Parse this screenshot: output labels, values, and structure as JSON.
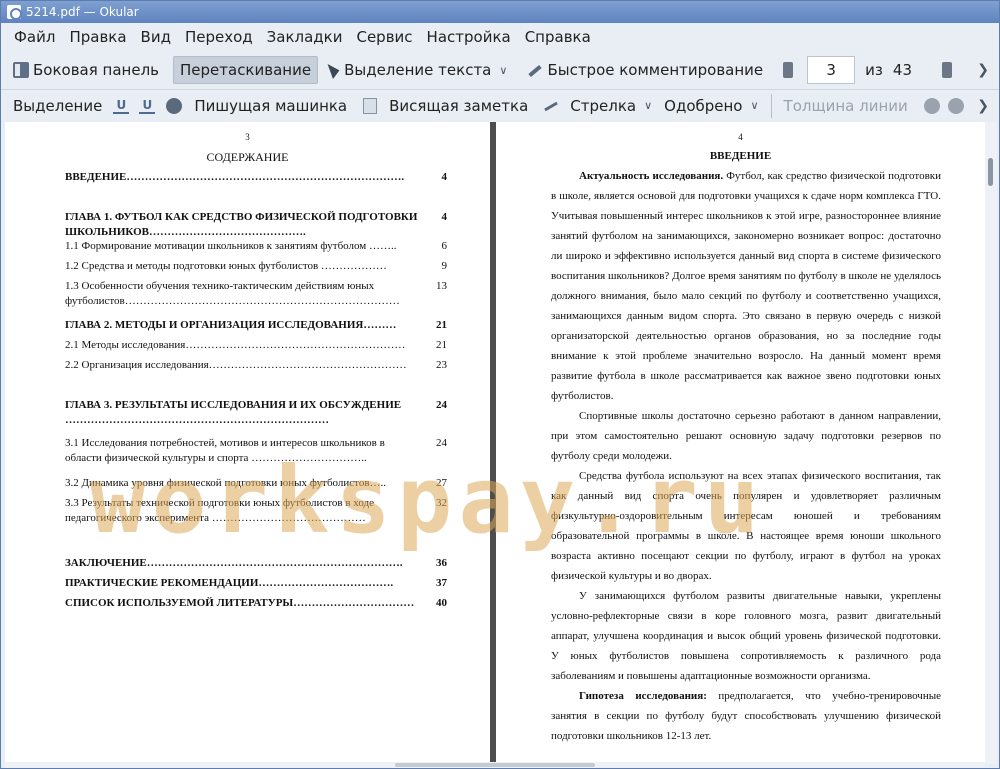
{
  "window": {
    "title": "5214.pdf  — Okular"
  },
  "menu": [
    "Файл",
    "Правка",
    "Вид",
    "Переход",
    "Закладки",
    "Сервис",
    "Настройка",
    "Справка"
  ],
  "toolbar1": {
    "sidebar": "Боковая панель",
    "drag": "Перетаскивание",
    "select_text": "Выделение текста",
    "quick_comment": "Быстрое комментирование",
    "page_current": "3",
    "page_of": "из",
    "page_total": "43"
  },
  "toolbar2": {
    "selection": "Выделение",
    "typewriter": "Пишущая машинка",
    "sticky_note": "Висящая заметка",
    "arrow": "Стрелка",
    "approved": "Одобрено",
    "line_width": "Толщина линии"
  },
  "left_page": {
    "number": "3",
    "title": "СОДЕРЖАНИЕ",
    "toc": [
      {
        "text": "ВВЕДЕНИЕ………………………………………………………………….",
        "page": "4",
        "bold": true
      },
      {
        "text": "ГЛАВА 1. ФУТБОЛ  КАК СРЕДСТВО ФИЗИЧЕСКОЙ ПОДГОТОВКИ ШКОЛЬНИКОВ…………………………………….",
        "page": "4",
        "bold": true
      },
      {
        "text": "1.1 Формирование мотивации школьников к занятиям футболом ……..",
        "page": "6",
        "bold": false
      },
      {
        "text": "1.2  Средства и методы подготовки юных футболистов ………………",
        "page": "9",
        "bold": false
      },
      {
        "text": "1.3 Особенности обучения технико-тактическим действиям юных футболистов…………………………………………………………………",
        "page": "13",
        "bold": false
      },
      {
        "text": "ГЛАВА 2. МЕТОДЫ И ОРГАНИЗАЦИЯ ИССЛЕДОВАНИЯ………",
        "page": "21",
        "bold": true
      },
      {
        "text": "2.1 Методы исследования……………………………………………………",
        "page": "21",
        "bold": false
      },
      {
        "text": "2.2 Организация исследования………………………………………………",
        "page": "23",
        "bold": false
      },
      {
        "text": "ГЛАВА 3. РЕЗУЛЬТАТЫ ИССЛЕДОВАНИЯ И ИХ ОБСУЖДЕНИЕ ………………………………………………………………",
        "page": "24",
        "bold": true
      },
      {
        "text": "3.1 Исследования потребностей, мотивов и интересов школьников в области физической культуры и спорта …………………………..",
        "page": "24",
        "bold": false
      },
      {
        "text": "3.2 Динамика уровня физической подготовки юных футболистов…..",
        "page": "27",
        "bold": false
      },
      {
        "text": "3.3 Результаты технической подготовки юных футболистов в ходе педагогического эксперимента ……………………………………",
        "page": "32",
        "bold": false
      },
      {
        "text": "ЗАКЛЮЧЕНИЕ…………………………………………………………….",
        "page": "36",
        "bold": true
      },
      {
        "text": " ПРАКТИЧЕСКИЕ РЕКОМЕНДАЦИИ……………………………….",
        "page": "37",
        "bold": true
      },
      {
        "text": "СПИСОК ИСПОЛЬЗУЕМОЙ ЛИТЕРАТУРЫ……………………………",
        "page": "40",
        "bold": true
      }
    ]
  },
  "right_page": {
    "number": "4",
    "heading": "ВВЕДЕНИЕ",
    "p1_lead": "Актуальность исследования.",
    "p1": " Футбол, как средство физической подготовки в школе, является основой для подготовки учащихся к сдаче норм комплекса ГТО. Учитывая повышенный интерес школьников к этой игре, разностороннее влияние занятий футболом на занимающихся, закономерно возникает вопрос: достаточно ли широко и эффективно используется данный вид спорта в системе физического воспитания школьников? Долгое время занятиям по футболу в школе не уделялось должного внимания, было мало секций по футболу и соответственно учащихся, занимающихся данным видом спорта. Это связано в первую очередь с низкой организаторской деятельностью органов образования, но за последние годы внимание к этой проблеме значительно возросло. На данный момент время развитие футбола в школе рассматривается как важное звено подготовки юных футболистов.",
    "p2": "Спортивные школы достаточно серьезно работают в данном направлении, при этом самостоятельно решают основную задачу подготовки резервов по футболу среди молодежи.",
    "p3": "Средства футбола используют на всех этапах физического воспитания, так как данный вид спорта очень популярен и удовлетворяет различным физкультурно-оздоровительным интересам юношей и требованиям образовательной программы в школе. В настоящее время юноши школьного возраста активно посещают секции по футболу, играют в футбол на уроках физической культуры и во дворах.",
    "p4": "У занимающихся футболом развиты двигательные навыки, укреплены условно-рефлекторные связи в коре головного мозга, развит двигательный аппарат, улучшена координация и высок общий уровень физической подготовки. У юных футболистов повышена сопротивляемость к различного рода заболеваниям и повышены адаптационные возможности организма.",
    "p5_lead": "Гипотеза исследования:",
    "p5": " предполагается, что учебно-тренировочные занятия в секции по футболу будут способствовать улучшению физической подготовки школьников 12-13 лет."
  },
  "watermark": "workspay.ru"
}
